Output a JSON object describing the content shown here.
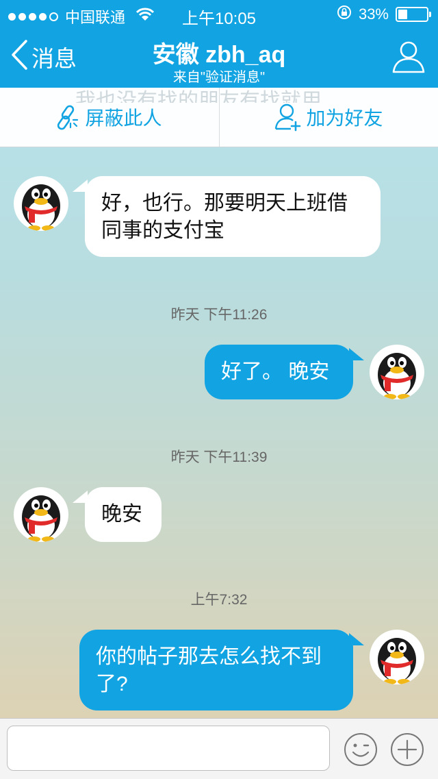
{
  "status_bar": {
    "carrier": "中国联通",
    "time": "上午10:05",
    "battery": "33%",
    "battery_level": 0.33
  },
  "nav": {
    "back_label": "消息",
    "title": "安徽 zbh_aq",
    "subtitle": "来自\"验证消息\""
  },
  "actions": {
    "block_label": "屏蔽此人",
    "add_friend_label": "加为好友",
    "hidden_text": "我也没有找的朋友有找就用"
  },
  "messages": [
    {
      "direction": "in",
      "text_line1": "好，也行。那要明天上班借",
      "text_line2": "同事的支付宝"
    },
    {
      "time": "昨天  下午11:26"
    },
    {
      "direction": "out",
      "text": "好了。 晚安"
    },
    {
      "time": "昨天  下午11:39"
    },
    {
      "direction": "in",
      "text": "晚安"
    },
    {
      "time": "上午7:32"
    },
    {
      "direction": "out",
      "text_line1": "你的帖子那去怎么找不到",
      "text_line2": "了?"
    }
  ],
  "input": {
    "placeholder": ""
  },
  "colors": {
    "accent": "#12a4e2",
    "incoming_bubble": "#ffffff",
    "outgoing_bubble": "#12a4e2"
  }
}
